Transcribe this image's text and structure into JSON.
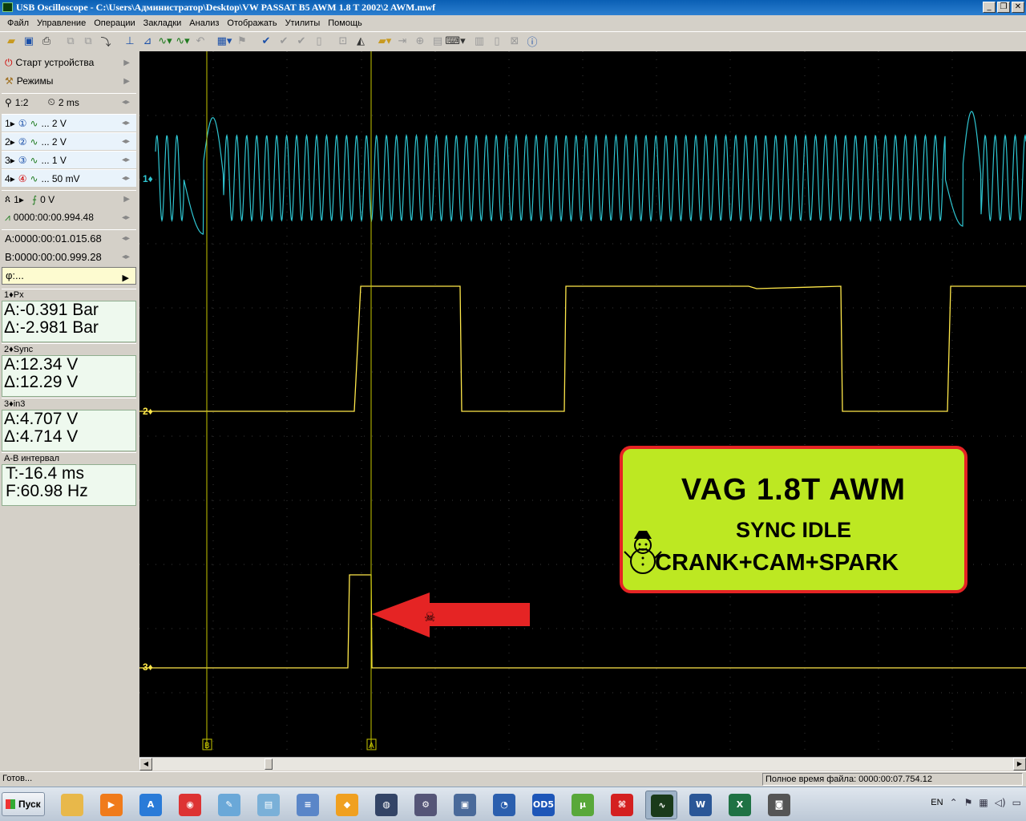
{
  "window": {
    "title": "USB Oscilloscope - C:\\Users\\Администратор\\Desktop\\VW PASSAT B5  AWM 1.8 T 2002\\2 AWM.mwf",
    "buttons": [
      "_",
      "❐",
      "✕"
    ]
  },
  "menu": [
    "Файл",
    "Управление",
    "Операции",
    "Закладки",
    "Анализ",
    "Отображать",
    "Утилиты",
    "Помощь"
  ],
  "left_panel": {
    "start_device": "Старт устройства",
    "modes": "Режимы",
    "zoom": "1:2",
    "timebase": "2 ms",
    "channels": [
      {
        "num": "1",
        "badge": "①",
        "range": "... 2 V"
      },
      {
        "num": "2",
        "badge": "②",
        "range": "... 2 V"
      },
      {
        "num": "3",
        "badge": "③",
        "range": "... 1 V"
      },
      {
        "num": "4",
        "badge": "④",
        "range": "... 50 mV"
      }
    ],
    "trigger": {
      "channel": "1",
      "level": "0 V"
    },
    "trigger_time": "0000:00:00.994.48",
    "cursor_a": "A:0000:00:01.015.68",
    "cursor_b": "B:0000:00:00.999.28",
    "phi": "φ:...",
    "measurements": [
      {
        "header": "1♦Px",
        "a": "A:-0.391 Bar",
        "d": "Δ:-2.981 Bar"
      },
      {
        "header": "2♦Sync",
        "a": "A:12.34 V",
        "d": "Δ:12.29 V"
      },
      {
        "header": "3♦in3",
        "a": "A:4.707 V",
        "d": "Δ:4.714 V"
      }
    ],
    "interval": {
      "header": "A-B интервал",
      "t": "T:-16.4 ms",
      "f": "F:60.98 Hz"
    }
  },
  "scope": {
    "channel_labels": [
      "1♦",
      "2♦",
      "3♦"
    ],
    "cursor_labels": [
      "B",
      "A"
    ],
    "colors": {
      "ch1": "#2fc6d2",
      "ch2": "#ffe84a",
      "ch3": "#ffe84a",
      "grid": "#3a3a3a",
      "cursor": "#c8c800",
      "arrow": "#e52424"
    }
  },
  "overlay": {
    "line1": "VAG  1.8T  AWM",
    "line2": "SYNC  IDLE",
    "line3": "CRANK+CAM+SPARK",
    "skull": "☠"
  },
  "status": {
    "left": "Готов...",
    "right": "Полное время файла: 0000:00:07.754.12"
  },
  "taskbar": {
    "start": "Пуск",
    "language": "EN",
    "apps": [
      {
        "name": "explorer",
        "color": "#e8b84a",
        "label": ""
      },
      {
        "name": "media",
        "color": "#f07b1b",
        "label": "▶"
      },
      {
        "name": "app-a",
        "color": "#2a7bd8",
        "label": "A"
      },
      {
        "name": "chrome",
        "color": "#d33",
        "label": "◉"
      },
      {
        "name": "paint",
        "color": "#6aa8d8",
        "label": "✎"
      },
      {
        "name": "notes",
        "color": "#7ab0d8",
        "label": "▤"
      },
      {
        "name": "notepad",
        "color": "#5a86c8",
        "label": "≡"
      },
      {
        "name": "skype-like",
        "color": "#f0a020",
        "label": "◆"
      },
      {
        "name": "globe",
        "color": "#334466",
        "label": "◍"
      },
      {
        "name": "tools",
        "color": "#557",
        "label": "⚙"
      },
      {
        "name": "devices",
        "color": "#4a6a9a",
        "label": "▣"
      },
      {
        "name": "pie",
        "color": "#2b5fae",
        "label": "◔"
      },
      {
        "name": "od5",
        "color": "#1d56b8",
        "label": "OD5"
      },
      {
        "name": "utorrent",
        "color": "#59a83a",
        "label": "µ"
      },
      {
        "name": "pdf",
        "color": "#d42020",
        "label": "⌘"
      },
      {
        "name": "oscilloscope",
        "color": "#1a3a1a",
        "label": "∿"
      },
      {
        "name": "word",
        "color": "#2b5797",
        "label": "W"
      },
      {
        "name": "excel",
        "color": "#1f7244",
        "label": "X"
      },
      {
        "name": "camera",
        "color": "#555",
        "label": "◙"
      }
    ]
  }
}
